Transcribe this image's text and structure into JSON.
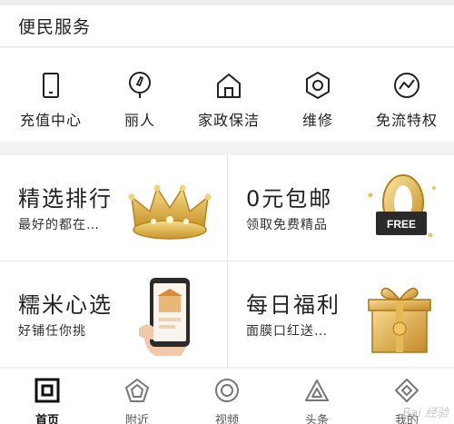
{
  "section": {
    "title": "便民服务"
  },
  "services": [
    {
      "label": "充值中心",
      "icon": "phone-icon"
    },
    {
      "label": "丽人",
      "icon": "lipstick-icon"
    },
    {
      "label": "家政保洁",
      "icon": "house-icon"
    },
    {
      "label": "维修",
      "icon": "wrench-nut-icon"
    },
    {
      "label": "免流特权",
      "icon": "traffic-wave-icon"
    }
  ],
  "promos": [
    {
      "title": "精选排行",
      "subtitle": "最好的都在…",
      "image": "crown-image"
    },
    {
      "title": "0元包邮",
      "subtitle": "领取免费精品",
      "image": "free-zero-image"
    },
    {
      "title": "糯米心选",
      "subtitle": "好铺任你挑",
      "image": "phone-in-hand-image"
    },
    {
      "title": "每日福利",
      "subtitle": "面膜口红送…",
      "image": "gift-box-image"
    }
  ],
  "tabs": [
    {
      "label": "首页",
      "icon": "home-square-icon",
      "active": true
    },
    {
      "label": "附近",
      "icon": "pentagon-icon",
      "active": false
    },
    {
      "label": "视频",
      "icon": "video-circle-icon",
      "active": false
    },
    {
      "label": "头条",
      "icon": "headline-triangle-icon",
      "active": false
    },
    {
      "label": "我的",
      "icon": "profile-diamond-icon",
      "active": false
    }
  ],
  "watermark": "Bai 经验"
}
